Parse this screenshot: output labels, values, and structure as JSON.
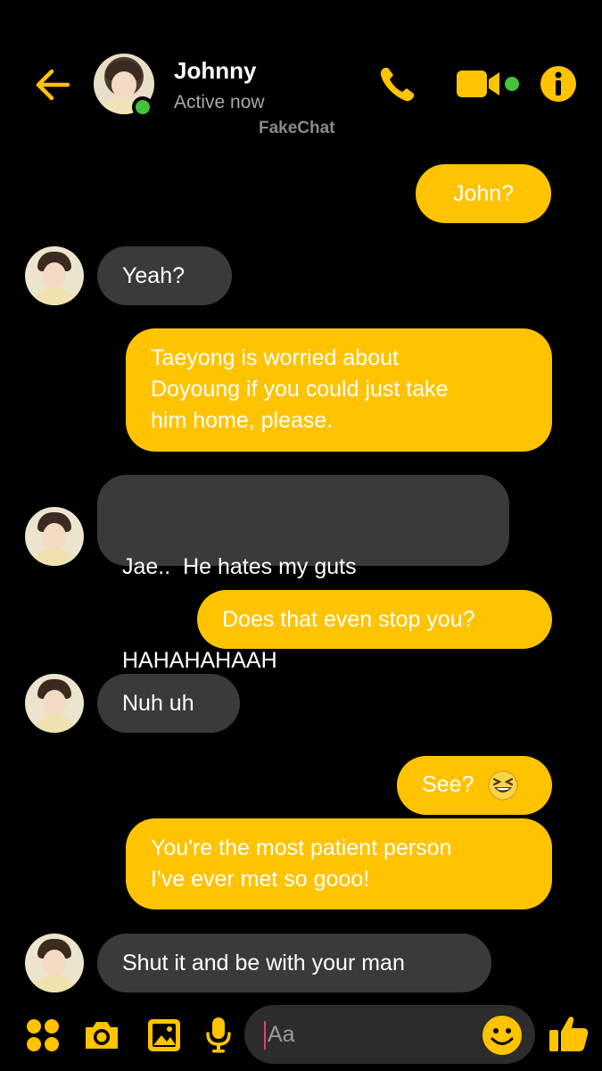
{
  "header": {
    "contact_name": "Johnny",
    "status": "Active now",
    "watermark": "FakeChat",
    "accent_color": "#ffc300",
    "online_color": "#44c23b",
    "icons": [
      "back-arrow-icon",
      "phone-icon",
      "video-camera-icon",
      "info-icon"
    ]
  },
  "messages": [
    {
      "sender": "me",
      "lines": [
        "John?"
      ]
    },
    {
      "sender": "them",
      "lines": [
        "Yeah?"
      ]
    },
    {
      "sender": "me",
      "lines": [
        "Taeyong is worried about",
        "Doyoung if you could just take",
        "him home, please."
      ]
    },
    {
      "sender": "them",
      "lines": [
        "Jae..  He hates my guts",
        "HAHAHAHAAH"
      ]
    },
    {
      "sender": "me",
      "lines": [
        "Does that even stop you?"
      ]
    },
    {
      "sender": "them",
      "lines": [
        "Nuh uh"
      ]
    },
    {
      "sender": "me",
      "lines": [
        "See?"
      ],
      "emoji": "grinning-squinting-face"
    },
    {
      "sender": "me",
      "lines": [
        "You're the most patient person",
        "I've ever met so gooo!"
      ]
    },
    {
      "sender": "them",
      "lines": [
        "Shut it and be with your man"
      ]
    }
  ],
  "composer": {
    "placeholder": "Aa",
    "icons": [
      "apps-icon",
      "camera-icon",
      "gallery-icon",
      "microphone-icon",
      "emoji-icon",
      "thumbs-up-icon"
    ]
  }
}
